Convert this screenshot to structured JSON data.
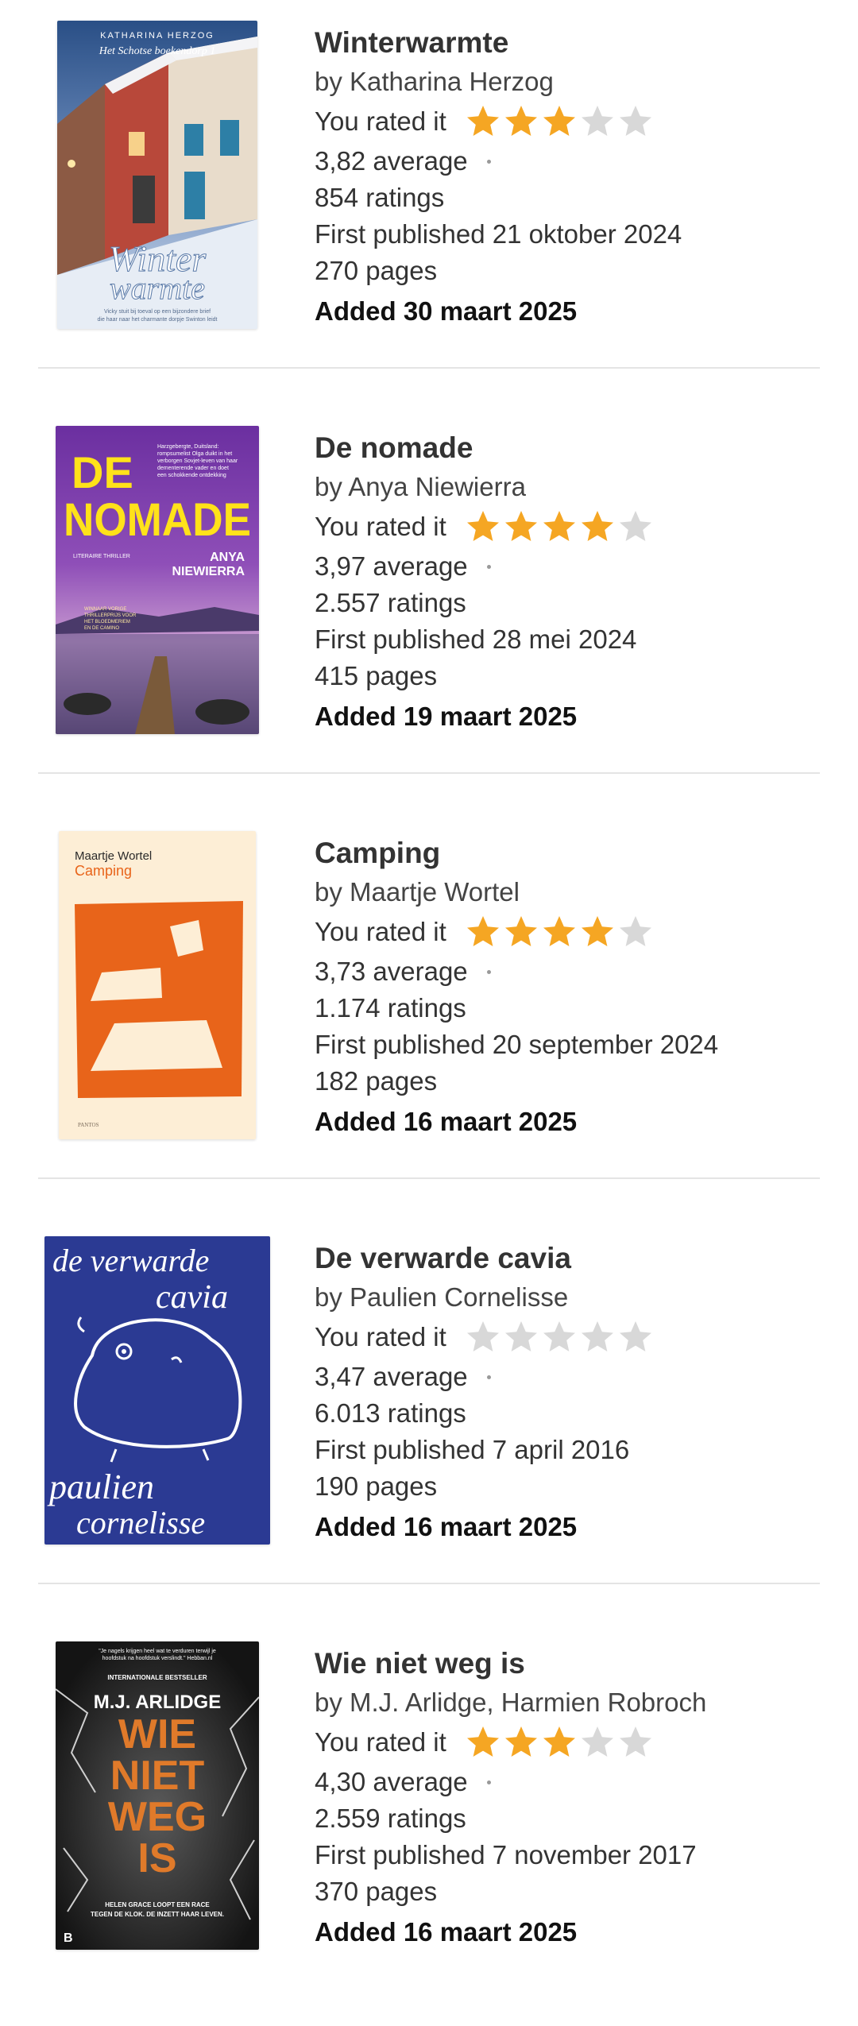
{
  "colors": {
    "star_filled": "#F5A623",
    "star_empty": "#D8D8D8",
    "separator": "#E4E4E4"
  },
  "rated_label": "You rated it",
  "books": [
    {
      "title": "Winterwarmte",
      "author": "by Katharina Herzog",
      "user_rating": 3,
      "average": "3,82 average",
      "ratings": "854 ratings",
      "published": "First published 21 oktober 2024",
      "pages": "270 pages",
      "added": "Added 30 maart 2025",
      "cover": {
        "author": "KATHARINA HERZOG",
        "tagline": "Het Schotse boekendorp 1",
        "title_line1": "Winter",
        "title_line2": "warmte",
        "blurb_line1": "Vicky stuit bij toeval op een bijzondere brief",
        "blurb_line2": "die haar naar het charmante dorpje Swinton leidt"
      }
    },
    {
      "title": "De nomade",
      "author": "by Anya Niewierra",
      "user_rating": 4,
      "average": "3,97 average",
      "ratings": "2.557 ratings",
      "published": "First published 28 mei 2024",
      "pages": "415 pages",
      "added": "Added 19 maart 2025",
      "cover": {
        "title_line1": "DE",
        "title_line2": "NOMADE",
        "author_line1": "ANYA",
        "author_line2": "NIEWIERRA",
        "genre": "LITERAIRE THRILLER",
        "blurb_line1": "Harzgebergte, Duitsland:",
        "blurb_line2": "rompsumelist Olga duikt in het",
        "blurb_line3": "verborgen Sovjet-leven van haar",
        "blurb_line4": "dementerende vader en doet",
        "blurb_line5": "een schokkende ontdekking",
        "award_line1": "WINNAAR VORIGE",
        "award_line2": "THRILLERPRIJS VOOR",
        "award_line3": "HET BLOEDMERIEM",
        "award_line4": "EN DE CAMINO"
      }
    },
    {
      "title": "Camping",
      "author": "by Maartje Wortel",
      "user_rating": 4,
      "average": "3,73 average",
      "ratings": "1.174 ratings",
      "published": "First published 20 september 2024",
      "pages": "182 pages",
      "added": "Added 16 maart 2025",
      "cover": {
        "author": "Maartje Wortel",
        "title": "Camping",
        "publisher": "PANTOS"
      }
    },
    {
      "title": "De verwarde cavia",
      "author": "by Paulien Cornelisse",
      "user_rating": 0,
      "average": "3,47 average",
      "ratings": "6.013 ratings",
      "published": "First published 7 april 2016",
      "pages": "190 pages",
      "added": "Added 16 maart 2025",
      "cover": {
        "title_line1": "de verwarde",
        "title_line2": "cavia",
        "author_line1": "paulien",
        "author_line2": "cornelisse"
      }
    },
    {
      "title": "Wie niet weg is",
      "author": "by M.J. Arlidge, Harmien Robroch",
      "user_rating": 3,
      "average": "4,30 average",
      "ratings": "2.559 ratings",
      "published": "First published 7 november 2017",
      "pages": "370 pages",
      "added": "Added 16 maart 2025",
      "cover": {
        "quote_line1": "\"Je nagels krijgen heel wat te verduren terwijl je",
        "quote_line2": "hoofdstuk na hoofdstuk verslindt.\" Hebban.nl",
        "badge": "INTERNATIONALE BESTSELLER",
        "author": "M.J. ARLIDGE",
        "title_line1": "WIE",
        "title_line2": "NIET",
        "title_line3": "WEG",
        "title_line4": "IS",
        "tagline_line1": "HELEN GRACE LOOPT EEN RACE",
        "tagline_line2": "TEGEN DE KLOK. DE INZETT HAAR LEVEN.",
        "publisher": "B"
      }
    }
  ]
}
